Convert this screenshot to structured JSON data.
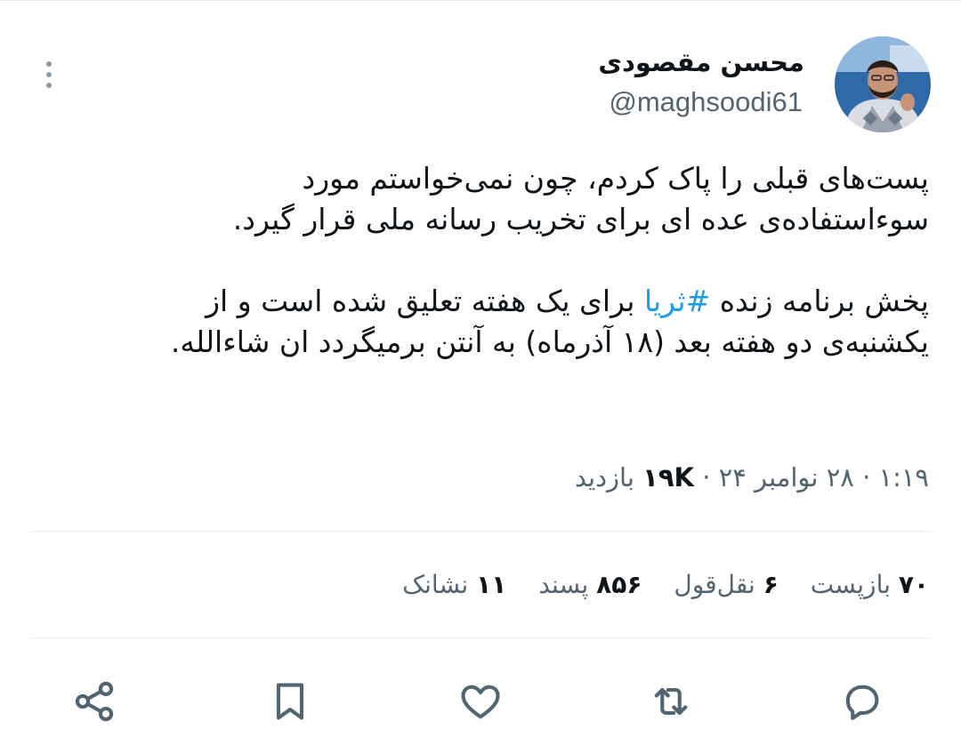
{
  "author": {
    "name": "محسن مقصودی",
    "handle": "@maghsoodi61"
  },
  "tweet": {
    "line_1": "پست‌های قبلی را پاک کردم، چون نمی‌خواستم مورد",
    "line_2": "سوءاستفاده‌ی عده ای برای تخریب رسانه ملی قرار گیرد.",
    "line_3_before": "پخش برنامه زنده ",
    "hashtag": "#ثریا",
    "line_3_after": " برای یک هفته تعلیق شده است و از",
    "line_4": "یکشنبه‌ی دو هفته بعد (۱۸ آذرماه) به آنتن برمیگردد ان شاءالله."
  },
  "meta": {
    "time": "۱:۱۹",
    "separator": "·",
    "date": "۲۸ نوامبر ۲۴",
    "views_count": "۱۹K",
    "views_label": "بازدید"
  },
  "stats": {
    "reposts_count": "۷۰",
    "reposts_label": "بازپست",
    "quotes_count": "۶",
    "quotes_label": "نقل‌قول",
    "likes_count": "۸۵۶",
    "likes_label": "پسند",
    "bookmarks_count": "۱۱",
    "bookmarks_label": "نشانک"
  },
  "icons": {
    "more": "more-vertical-icon",
    "reply": "reply-bubble-icon",
    "retweet": "retweet-icon",
    "like": "heart-icon",
    "bookmark": "bookmark-icon",
    "share": "share-icon"
  },
  "colors": {
    "text_primary": "#0f1419",
    "text_secondary": "#536471",
    "hashtag": "#1d9bf0",
    "divider": "#e6ecf0"
  }
}
